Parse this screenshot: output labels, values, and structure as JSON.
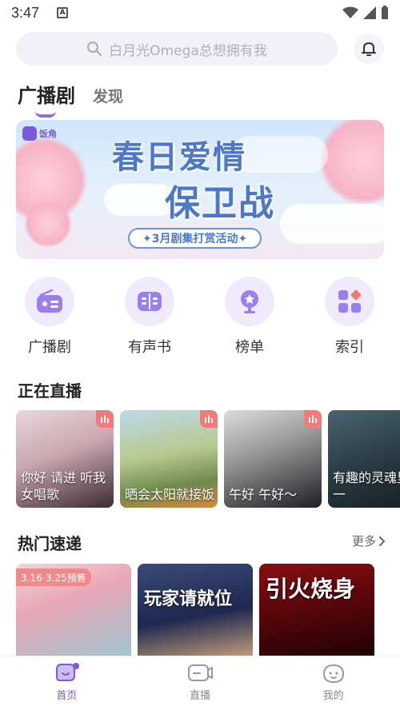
{
  "status_bar": {
    "time": "3:47",
    "notif": "A"
  },
  "search": {
    "placeholder": "白月光Omega总想拥有我"
  },
  "tabs": [
    {
      "label": "广播剧",
      "active": true
    },
    {
      "label": "发现",
      "active": false
    }
  ],
  "banner": {
    "brand": "饭角",
    "title_line1": "春日爱情",
    "title_line2": "保卫战",
    "subtitle": "✦3月剧集打赏活动✦"
  },
  "shortcuts": [
    {
      "label": "广播剧",
      "icon": "radio-icon"
    },
    {
      "label": "有声书",
      "icon": "book-icon"
    },
    {
      "label": "榜单",
      "icon": "trophy-icon"
    },
    {
      "label": "索引",
      "icon": "grid-index-icon"
    }
  ],
  "live_section": {
    "title": "正在直播",
    "items": [
      {
        "caption": "你好 请进 听我女唱歌"
      },
      {
        "caption": "晒会太阳就接饭"
      },
      {
        "caption": "午好 午好～"
      },
      {
        "caption": "有趣的灵魂里挑一"
      }
    ]
  },
  "hot_section": {
    "title": "热门速递",
    "more": "更多",
    "items": [
      {
        "tag": "3.16-3.25预售",
        "text": ""
      },
      {
        "tag": "",
        "text": "玩家请就位"
      },
      {
        "tag": "",
        "text": "引火烧身"
      }
    ]
  },
  "bottom_nav": [
    {
      "label": "首页",
      "active": true
    },
    {
      "label": "直播",
      "active": false
    },
    {
      "label": "我的",
      "active": false
    }
  ],
  "colors": {
    "accent": "#7a5ad8",
    "live_indicator": "#f47a7a"
  }
}
